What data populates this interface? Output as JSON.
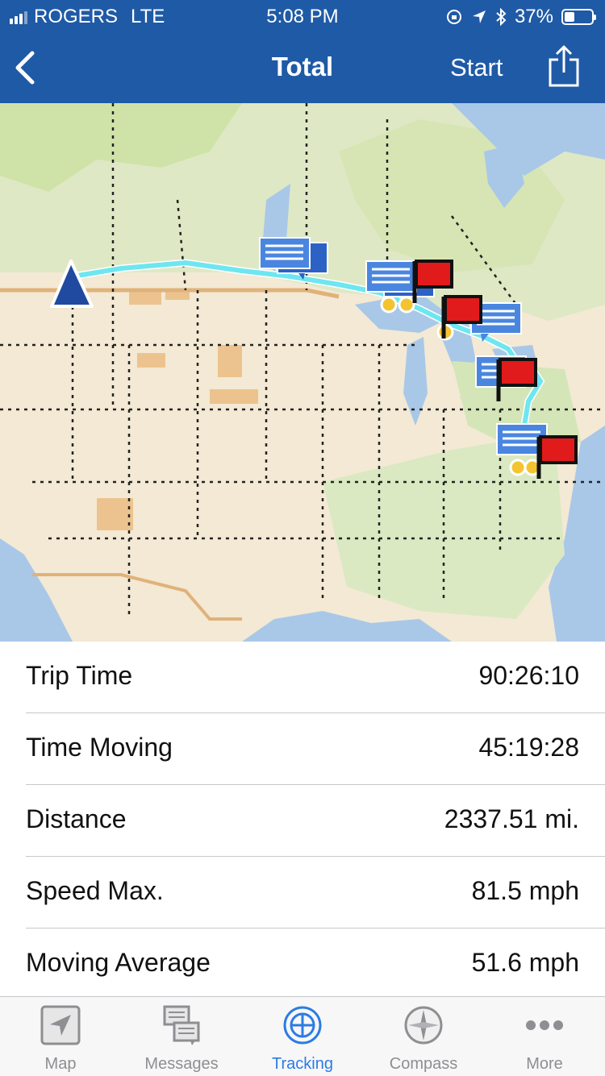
{
  "status_bar": {
    "carrier": "ROGERS",
    "network": "LTE",
    "time": "5:08 PM",
    "battery": "37%",
    "battery_level": 0.37
  },
  "nav": {
    "title": "Total",
    "start_label": "Start"
  },
  "stats": [
    {
      "label": "Trip Time",
      "value": "90:26:10"
    },
    {
      "label": "Time Moving",
      "value": "45:19:28"
    },
    {
      "label": "Distance",
      "value": "2337.51 mi."
    },
    {
      "label": "Speed Max.",
      "value": "81.5 mph"
    },
    {
      "label": "Moving Average",
      "value": "51.6 mph"
    }
  ],
  "tabs": [
    {
      "label": "Map",
      "icon": "map-arrow-icon",
      "active": false
    },
    {
      "label": "Messages",
      "icon": "messages-icon",
      "active": false
    },
    {
      "label": "Tracking",
      "icon": "tracking-icon",
      "active": true
    },
    {
      "label": "Compass",
      "icon": "compass-icon",
      "active": false
    },
    {
      "label": "More",
      "icon": "more-dots-icon",
      "active": false
    }
  ],
  "colors": {
    "header": "#1f5aa6",
    "track": "#6ee6f0",
    "accent": "#2c7be5",
    "flag": "#e11b1b"
  }
}
